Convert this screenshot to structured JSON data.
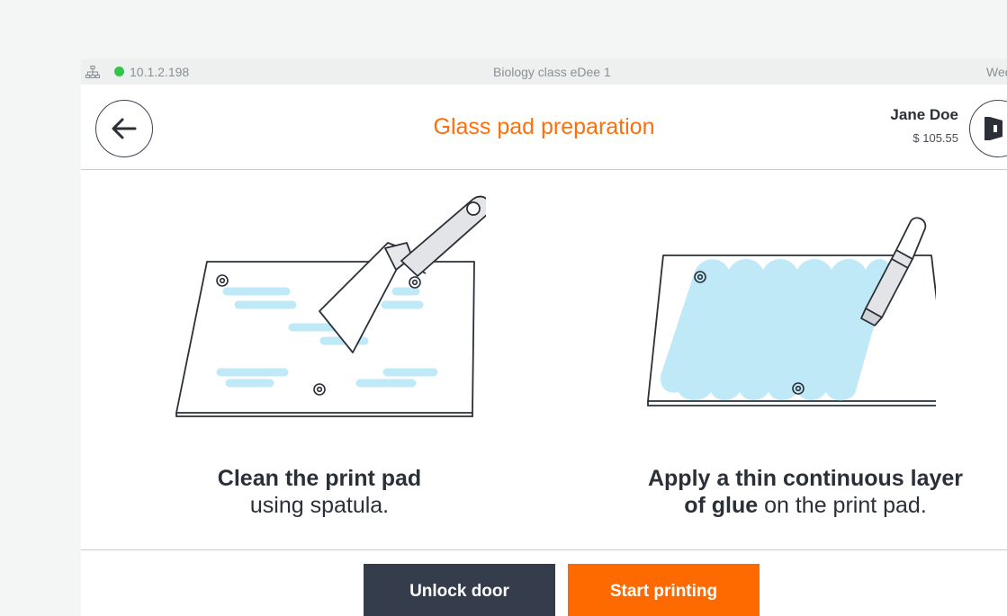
{
  "status_bar": {
    "ip": "10.1.2.198",
    "class_name": "Biology class eDee 1",
    "day": "Wed",
    "connection_color": "#35c44b",
    "network_icon": "network-icon"
  },
  "header": {
    "title": "Glass pad preparation",
    "user_name": "Jane Doe",
    "balance": "$ 105.55",
    "back_icon": "arrow-left-icon",
    "logout_icon": "logout-door-icon"
  },
  "steps": [
    {
      "bold": "Clean the print pad",
      "text": "using spatula.",
      "icon": "spatula-cleaning-illustration"
    },
    {
      "bold_1": "Apply a thin continuous layer",
      "bold_2": "of glue",
      "text": " on the print pad.",
      "icon": "glue-stick-illustration"
    }
  ],
  "actions": {
    "unlock_label": "Unlock door",
    "start_label": "Start printing"
  },
  "colors": {
    "accent": "#ff6e0a",
    "dark_button": "#353d4d",
    "glue": "#bfe9f7"
  }
}
